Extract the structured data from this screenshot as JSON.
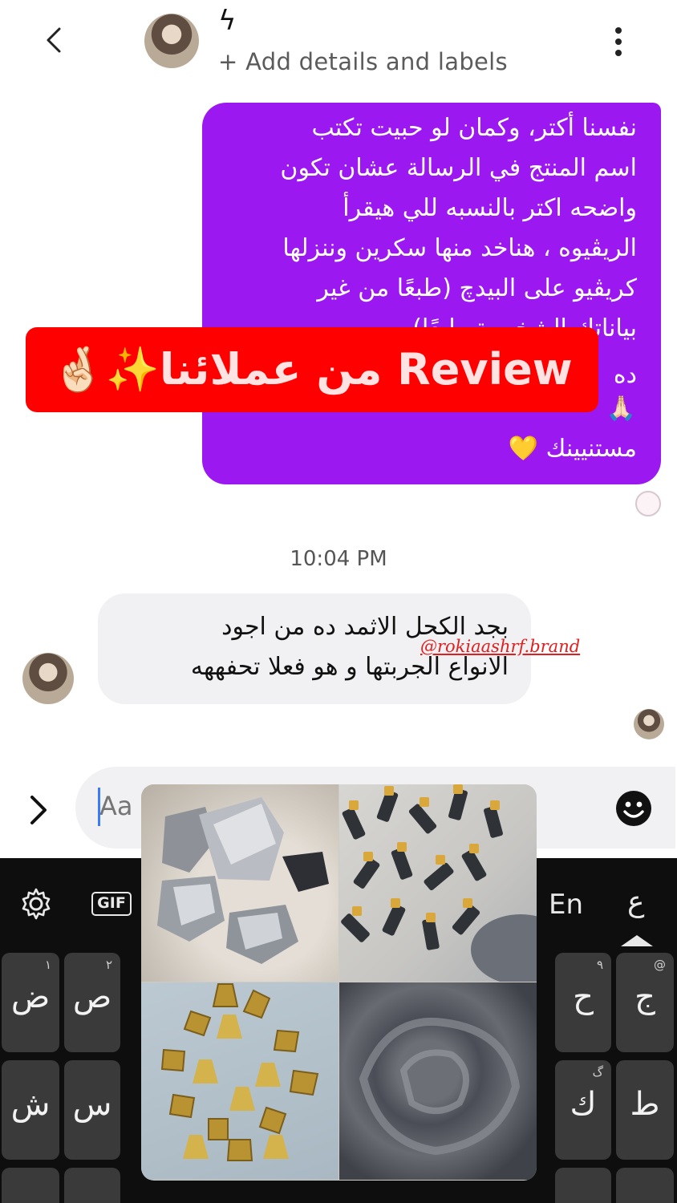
{
  "header": {
    "title_glyph": "ϟ",
    "subtitle": "+ Add details and labels",
    "back_icon": "chevron-left-icon",
    "menu_icon": "more-vertical-icon"
  },
  "outgoing_message": {
    "lines": [
      "نفسنا أكتر، وكمان لو حبيت تكتب",
      "اسم المنتج في الرسالة عشان تكون",
      "واضحه اكتر بالنسبه للي هيقرأ",
      "الريڤيوه ، هناخد منها سكرين وننزلها",
      "كريڤيو على البيدچ (طبعًا من غير",
      "بياناتك الشخصية طبعًا)",
      "ده",
      "🙏🏻",
      "مستنيينك 💛"
    ],
    "color": "#9b18f0"
  },
  "banner": {
    "text": "🤞🏻✨من عملائنا Review",
    "color": "#ff0000"
  },
  "timestamp": "10:04 PM",
  "incoming_message": {
    "lines": [
      "بجد الكحل الاثمد ده من اجود",
      "الانواع الجربتها و هو فعلا تحفههه"
    ],
    "watermark": "@rokiaashrf.brand"
  },
  "composer": {
    "placeholder": "Aa",
    "expand_icon": "chevron-right-icon",
    "emoji_icon": "smiley-icon"
  },
  "keyboard": {
    "toolbar": {
      "settings_icon": "gear-icon",
      "gif_label": "GIF",
      "lang_en": "En",
      "lang_ar": "ع"
    },
    "row1": [
      {
        "hint": "١",
        "char": "ض"
      },
      {
        "hint": "٢",
        "char": "ص"
      },
      {
        "hint": "@",
        "char": "ج"
      },
      {
        "hint": "٩",
        "char": "ح"
      }
    ],
    "row2": [
      {
        "hint": "",
        "char": "ش"
      },
      {
        "hint": "",
        "char": "س"
      },
      {
        "hint": "گ",
        "char": "ك"
      },
      {
        "hint": "",
        "char": "ط"
      }
    ]
  },
  "collage": {
    "tiles": [
      "silver-ore-stones",
      "kohl-bottles-gold-caps",
      "brass-kohl-applicators",
      "black-kohl-powder"
    ]
  }
}
